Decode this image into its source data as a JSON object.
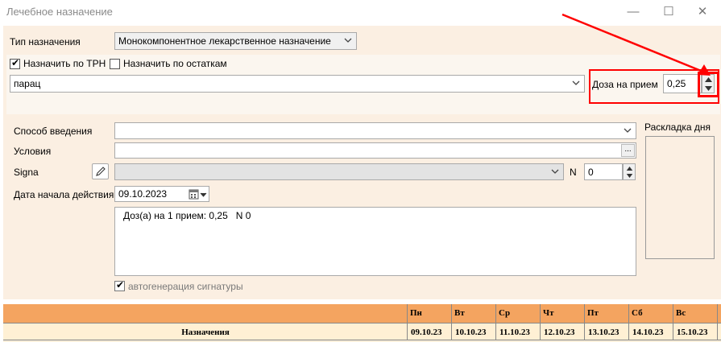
{
  "window": {
    "title": "Лечебное назначение",
    "minimize_glyph": "—",
    "maximize_glyph": "☐",
    "close_glyph": "✕"
  },
  "type_row": {
    "label": "Тип назначения",
    "value": "Монокомпонентное лекарственное назначение"
  },
  "checkboxes": [
    {
      "label": "Назначить по ТРН",
      "checked": true
    },
    {
      "label": "Назначить по остаткам",
      "checked": false
    }
  ],
  "drug_search": {
    "value": "парац"
  },
  "dose": {
    "label": "Доза на прием",
    "value": "0,25"
  },
  "route": {
    "label": "Способ введения",
    "value": ""
  },
  "conditions": {
    "label": "Условия",
    "value": "",
    "browse_label": "..."
  },
  "signa": {
    "label": "Signa",
    "value": "",
    "n_label": "N",
    "n_value": "0"
  },
  "start_date": {
    "label": "Дата начала действия",
    "value": "09.10.2023"
  },
  "signa_text": "Доз(а) на 1 прием: 0,25   N 0",
  "autogen": {
    "label": "автогенерация сигнатуры",
    "checked": true
  },
  "day_layout": {
    "label": "Раскладка дня"
  },
  "schedule": {
    "row_label": "Назначения",
    "days": [
      {
        "name": "Пн",
        "date": "09.10.23"
      },
      {
        "name": "Вт",
        "date": "10.10.23"
      },
      {
        "name": "Ср",
        "date": "11.10.23"
      },
      {
        "name": "Чт",
        "date": "12.10.23"
      },
      {
        "name": "Пт",
        "date": "13.10.23"
      },
      {
        "name": "Сб",
        "date": "14.10.23"
      },
      {
        "name": "Вс",
        "date": "15.10.23"
      }
    ]
  },
  "colors": {
    "annotation_red": "#ff0000",
    "header_orange": "#f4a460",
    "panel_bg": "#fbefe2"
  }
}
